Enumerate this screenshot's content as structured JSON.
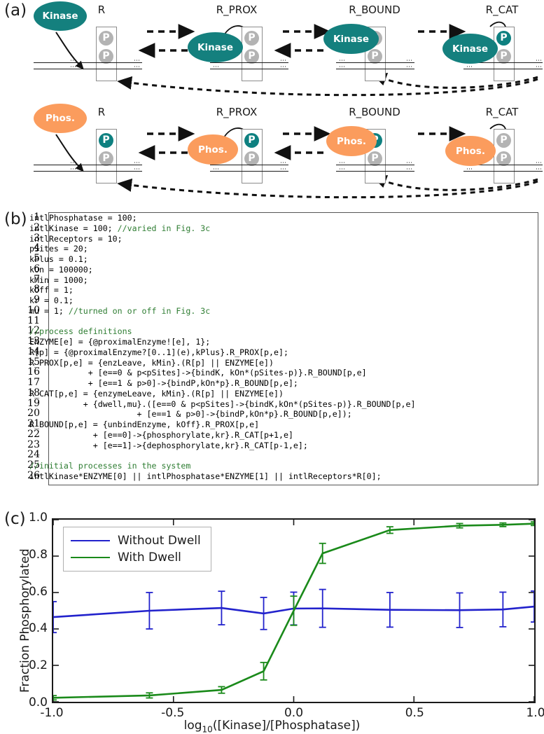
{
  "panels": {
    "a": {
      "letter": "(a)"
    },
    "b": {
      "letter": "(b)"
    },
    "c": {
      "letter": "(c)"
    }
  },
  "diagram": {
    "state_labels": [
      "R",
      "R_PROX",
      "R_BOUND",
      "R_CAT"
    ],
    "psite_letter": "P",
    "membrane_dots": "⋯",
    "rows": [
      {
        "enzyme_name": "Kinase",
        "color": "#14807e"
      },
      {
        "enzyme_name": "Phos.",
        "color": "#fb9c5d"
      }
    ]
  },
  "code": {
    "comment_color": "#2e7d32",
    "line_numbers": [
      1,
      2,
      3,
      4,
      5,
      6,
      7,
      8,
      9,
      10,
      11,
      12,
      13,
      14,
      15,
      16,
      17,
      18,
      19,
      20,
      21,
      22,
      23,
      24,
      25,
      26
    ],
    "lines": [
      [
        {
          "t": "intlPhosphatase = 100;"
        }
      ],
      [
        {
          "t": "intlKinase = 100; "
        },
        {
          "t": "//varied in Fig. 3c",
          "c": true
        }
      ],
      [
        {
          "t": "intlReceptors = 10;"
        }
      ],
      [
        {
          "t": "pSites = 20;"
        }
      ],
      [
        {
          "t": "kPlus = 0.1;"
        }
      ],
      [
        {
          "t": "kOn = 100000;"
        }
      ],
      [
        {
          "t": "kMin = 1000;"
        }
      ],
      [
        {
          "t": "kOff = 1;"
        }
      ],
      [
        {
          "t": "kr = 0.1;"
        }
      ],
      [
        {
          "t": "mu = 1; "
        },
        {
          "t": "//turned on or off in Fig. 3c",
          "c": true
        }
      ],
      [
        {
          "t": ""
        }
      ],
      [
        {
          "t": "//process definitions",
          "c": true
        }
      ],
      [
        {
          "t": "ENZYME[e] = {@proximalEnzyme![e], 1};"
        }
      ],
      [
        {
          "t": "R[p] = {@proximalEnzyme?[0..1](e),kPlus}.R_PROX[p,e];"
        }
      ],
      [
        {
          "t": "R_PROX[p,e] = {enzLeave, kMin}.(R[p] || ENZYME[e])"
        }
      ],
      [
        {
          "t": "            + [e==0 & p<pSites]->{bindK, kOn*(pSites-p)}.R_BOUND[p,e]"
        }
      ],
      [
        {
          "t": "            + [e==1 & p>0]->{bindP,kOn*p}.R_BOUND[p,e];"
        }
      ],
      [
        {
          "t": "R_CAT[p,e] = {enzymeLeave, kMin}.(R[p] || ENZYME[e])"
        }
      ],
      [
        {
          "t": "           + {dwell,mu}.([e==0 & p<pSites]->{bindK,kOn*(pSites-p)}.R_BOUND[p,e]"
        }
      ],
      [
        {
          "t": "                      + [e==1 & p>0]->{bindP,kOn*p}.R_BOUND[p,e]);"
        }
      ],
      [
        {
          "t": "R_BOUND[p,e] = {unbindEnzyme, kOff}.R_PROX[p,e]"
        }
      ],
      [
        {
          "t": "             + [e==0]->{phosphorylate,kr}.R_CAT[p+1,e]"
        }
      ],
      [
        {
          "t": "             + [e==1]->{dephosphorylate,kr}.R_CAT[p-1,e];"
        }
      ],
      [
        {
          "t": ""
        }
      ],
      [
        {
          "t": "//initial processes in the system",
          "c": true
        }
      ],
      [
        {
          "t": "intlKinase*ENZYME[0] || intlPhosphatase*ENZYME[1] || intlReceptors*R[0];"
        }
      ]
    ]
  },
  "chart_data": {
    "type": "line",
    "title": "",
    "xlabel": "log10([Kinase]/[Phosphatase])",
    "xlabel_base": "log",
    "xlabel_sub": "10",
    "xlabel_rest": "([Kinase]/[Phosphatase])",
    "ylabel": "Fraction Phosphorylated",
    "xlim": [
      -1.0,
      1.0
    ],
    "ylim": [
      0.0,
      1.0
    ],
    "xticks": [
      -1.0,
      -0.5,
      0.0,
      0.5,
      1.0
    ],
    "xtick_labels": [
      "-1.0",
      "-0.5",
      "0.0",
      "0.5",
      "1.0"
    ],
    "yticks": [
      0.0,
      0.2,
      0.4,
      0.6,
      0.8,
      1.0
    ],
    "ytick_labels": [
      "0.0",
      "0.2",
      "0.4",
      "0.6",
      "0.8",
      "1.0"
    ],
    "grid": false,
    "legend_position": "upper-left",
    "series": [
      {
        "name": "Without Dwell",
        "color": "#2222cc",
        "x": [
          -1.0,
          -0.6,
          -0.3,
          -0.125,
          0.0,
          0.12,
          0.4,
          0.69,
          0.87,
          1.0
        ],
        "values": [
          0.465,
          0.5,
          0.515,
          0.485,
          0.512,
          0.513,
          0.505,
          0.503,
          0.507,
          0.523
        ],
        "errors": [
          0.085,
          0.1,
          0.092,
          0.088,
          0.09,
          0.104,
          0.095,
          0.095,
          0.095,
          0.085
        ]
      },
      {
        "name": "With Dwell",
        "color": "#1a8a1a",
        "x": [
          -1.0,
          -0.6,
          -0.3,
          -0.125,
          0.0,
          0.12,
          0.4,
          0.69,
          0.87,
          1.0
        ],
        "values": [
          0.022,
          0.035,
          0.065,
          0.168,
          0.5,
          0.815,
          0.943,
          0.967,
          0.972,
          0.978
        ],
        "errors": [
          0.012,
          0.014,
          0.018,
          0.048,
          0.08,
          0.055,
          0.018,
          0.012,
          0.01,
          0.01
        ]
      }
    ]
  }
}
